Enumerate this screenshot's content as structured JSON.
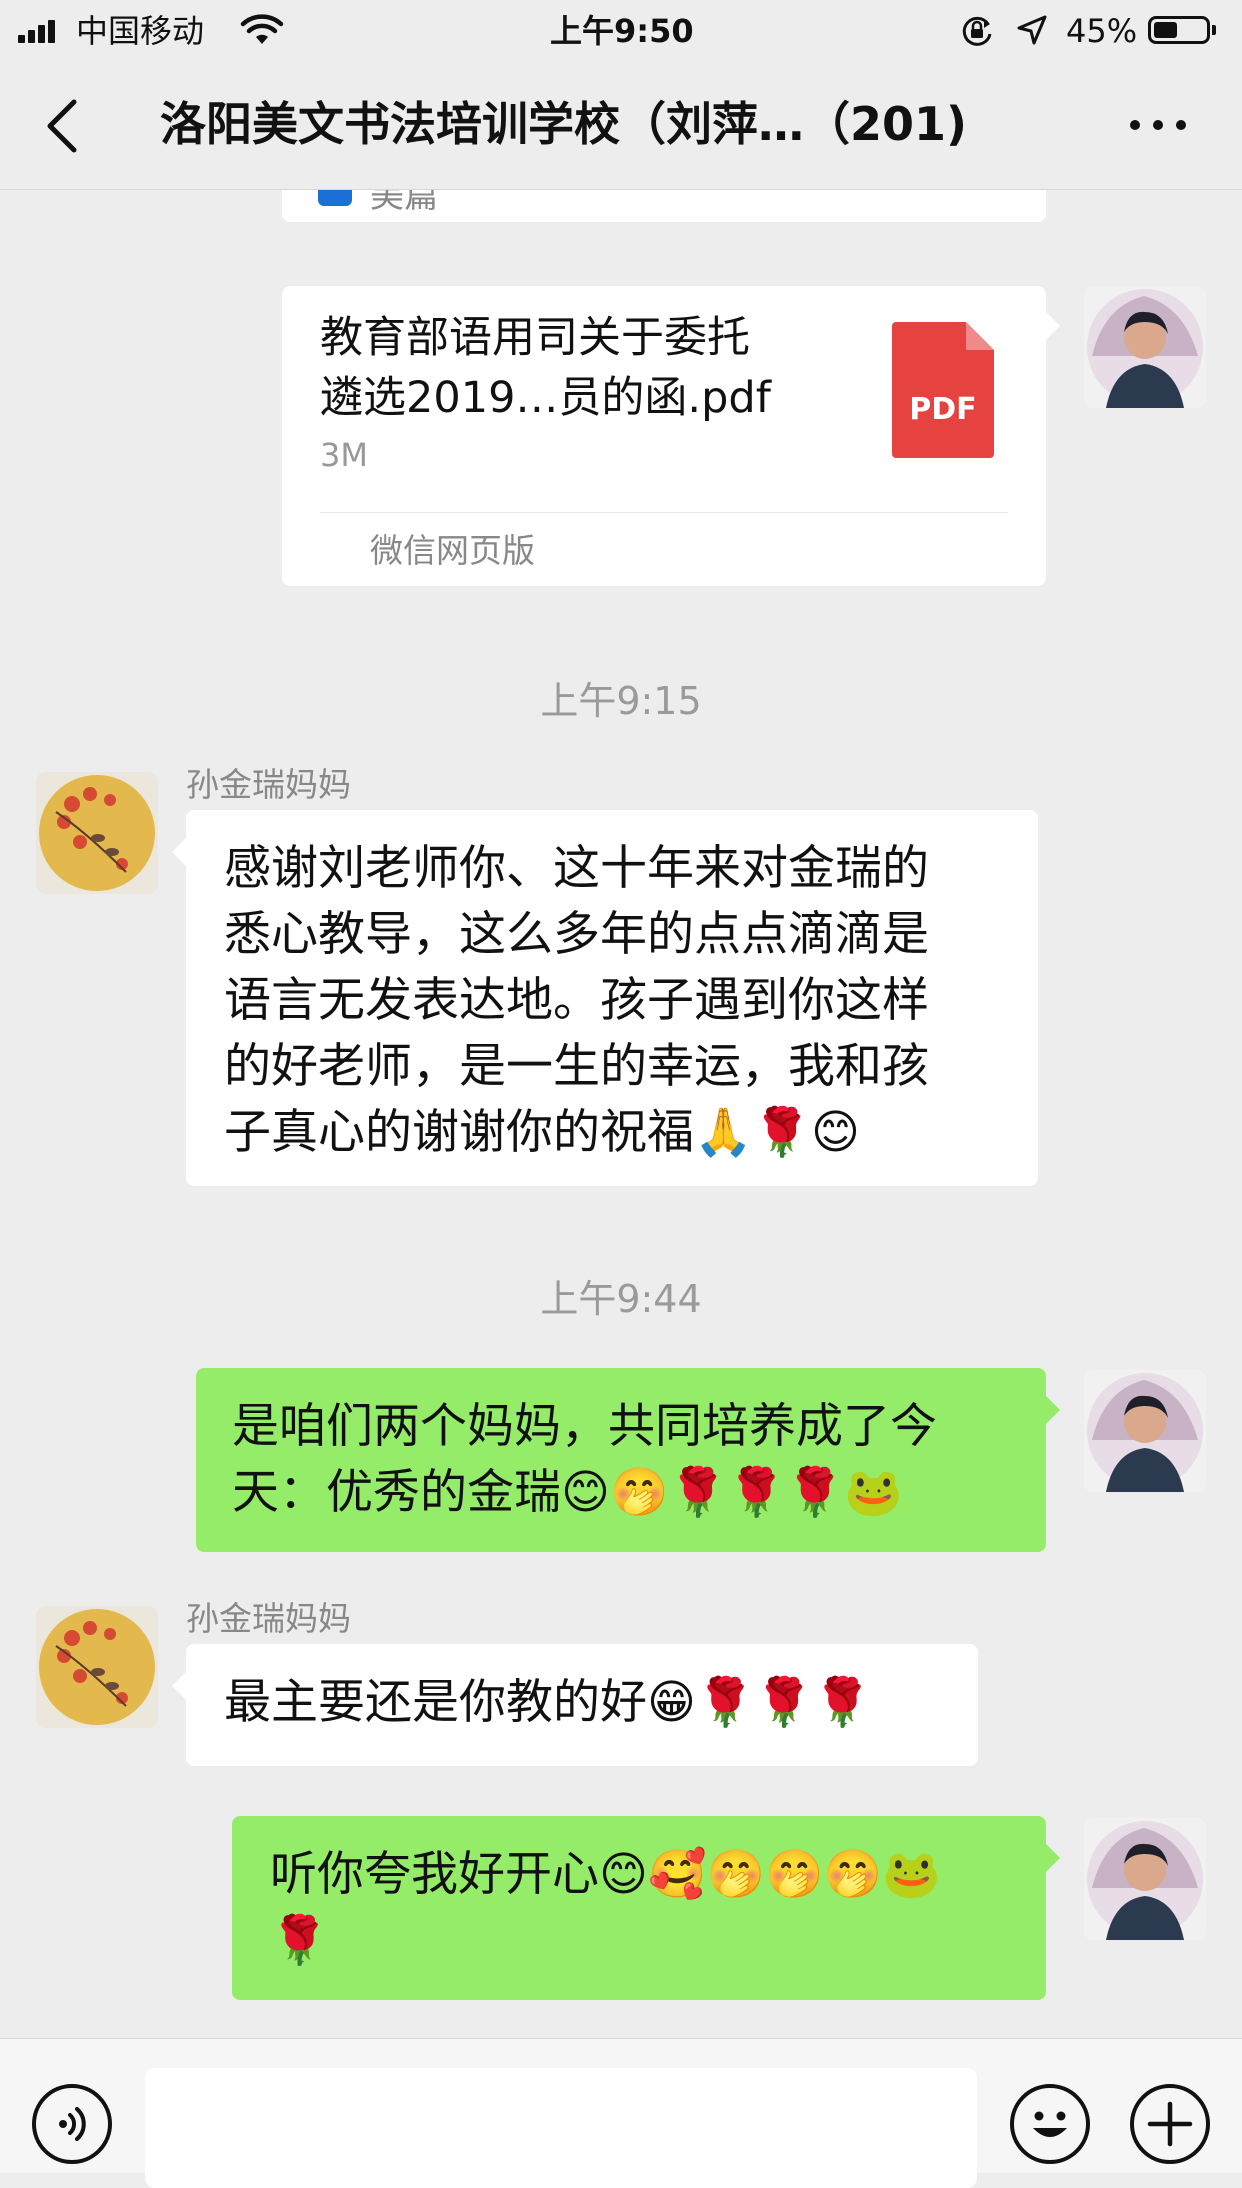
{
  "status_bar": {
    "carrier": "中国移动",
    "time": "上午9:50",
    "battery_pct": "45%",
    "battery_level": 0.45
  },
  "nav": {
    "title": "洛阳美文书法培训学校（刘萍…（201)"
  },
  "chat": {
    "partial_top_card": {
      "source": "美篇"
    },
    "file_card": {
      "title": "教育部语用司关于委托遴选2019…员的函.pdf",
      "title_line1": "教育部语用司关于委托",
      "title_line2": "遴选2019…员的函.pdf",
      "size": "3M",
      "badge": "PDF",
      "footer": "微信网页版"
    },
    "time_1": "上午9:15",
    "msg_1": {
      "sender": "孙金瑞妈妈",
      "line1": "感谢刘老师你、这十年来对金瑞的",
      "line2": "悉心教导，这么多年的点点滴滴是",
      "line3": "语言无发表达地。孩子遇到你这样",
      "line4": "的好老师，是一生的幸运，我和孩",
      "line5": "子真心的谢谢你的祝福🙏🌹😊"
    },
    "time_2": "上午9:44",
    "msg_2": {
      "line1": "是咱们两个妈妈，共同培养成了今",
      "line2": "天：优秀的金瑞😊🤭🌹🌹🌹🐸"
    },
    "msg_3": {
      "sender": "孙金瑞妈妈",
      "text": "最主要还是你教的好😁🌹🌹🌹"
    },
    "msg_4": {
      "line1": "听你夸我好开心😊🥰🤭🤭🤭🐸",
      "line2": "🌹"
    }
  },
  "icons": {
    "back": "chevron-left-icon",
    "more": "more-dots-icon",
    "voice": "voice-icon",
    "emoji": "emoji-icon",
    "plus": "plus-icon",
    "pdf": "pdf-file-icon"
  },
  "colors": {
    "background": "#ededed",
    "outgoing_bubble": "#95ec69",
    "incoming_bubble": "#ffffff",
    "pdf_red": "#e64340"
  }
}
